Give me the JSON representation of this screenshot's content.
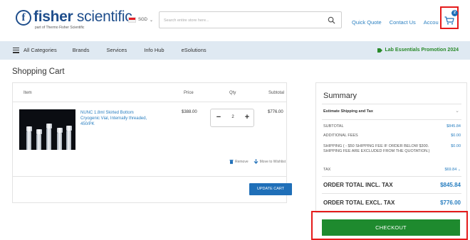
{
  "header": {
    "logo_word_bold": "fisher",
    "logo_word_light": " scientific",
    "logo_letter": "f",
    "logo_sub": "part of Thermo Fisher Scientific",
    "currency": "SGD",
    "search_placeholder": "Search entire store here...",
    "links": [
      "Quick Quote",
      "Contact Us",
      "Accou"
    ],
    "cart_count": "2"
  },
  "nav": {
    "items": [
      "All Categories",
      "Brands",
      "Services",
      "Info Hub",
      "eSolutions"
    ],
    "promo": "Lab Essentials Promotion 2024"
  },
  "page": {
    "title": "Shopping Cart"
  },
  "cart": {
    "headers": {
      "item": "Item",
      "price": "Price",
      "qty": "Qty",
      "subtotal": "Subtotal"
    },
    "item": {
      "name": "NUNC 1.8ml Skirted Bottom Cryogenic Vial, Internally threaded, 450/PK",
      "price": "$388.00",
      "qty": "2",
      "subtotal": "$776.00"
    },
    "actions": {
      "remove": "Remove",
      "wishlist": "Move to Wishlist"
    },
    "update_label": "UPDATE CART"
  },
  "summary": {
    "title": "Summary",
    "estimate": "Estimate Shipping and Tax",
    "subtotal_label": "SUBTOTAL",
    "subtotal_value": "$845.84",
    "fees_label": "ADDITIONAL FEES",
    "fees_value": "$0.00",
    "shipping_label": "SHIPPING ( - $50 SHIPPING FEE IF ORDER BELOW $300. SHIPPING FEE ARE EXCLUDED FROM THE QUOTATION.)",
    "shipping_value": "$0.00",
    "tax_label": "TAX",
    "tax_value": "$69.84",
    "total_incl_label": "ORDER TOTAL INCL. TAX",
    "total_incl_value": "$845.84",
    "total_excl_label": "ORDER TOTAL EXCL. TAX",
    "total_excl_value": "$776.00",
    "checkout_label": "CHECKOUT"
  },
  "colors": {
    "brand": "#1f4e8c",
    "link": "#2a7fc0",
    "nav_bg": "#dfe9f2",
    "primary_button": "#1f6fb8",
    "checkout_button": "#1e8a2e",
    "highlight": "#e51b1b"
  }
}
